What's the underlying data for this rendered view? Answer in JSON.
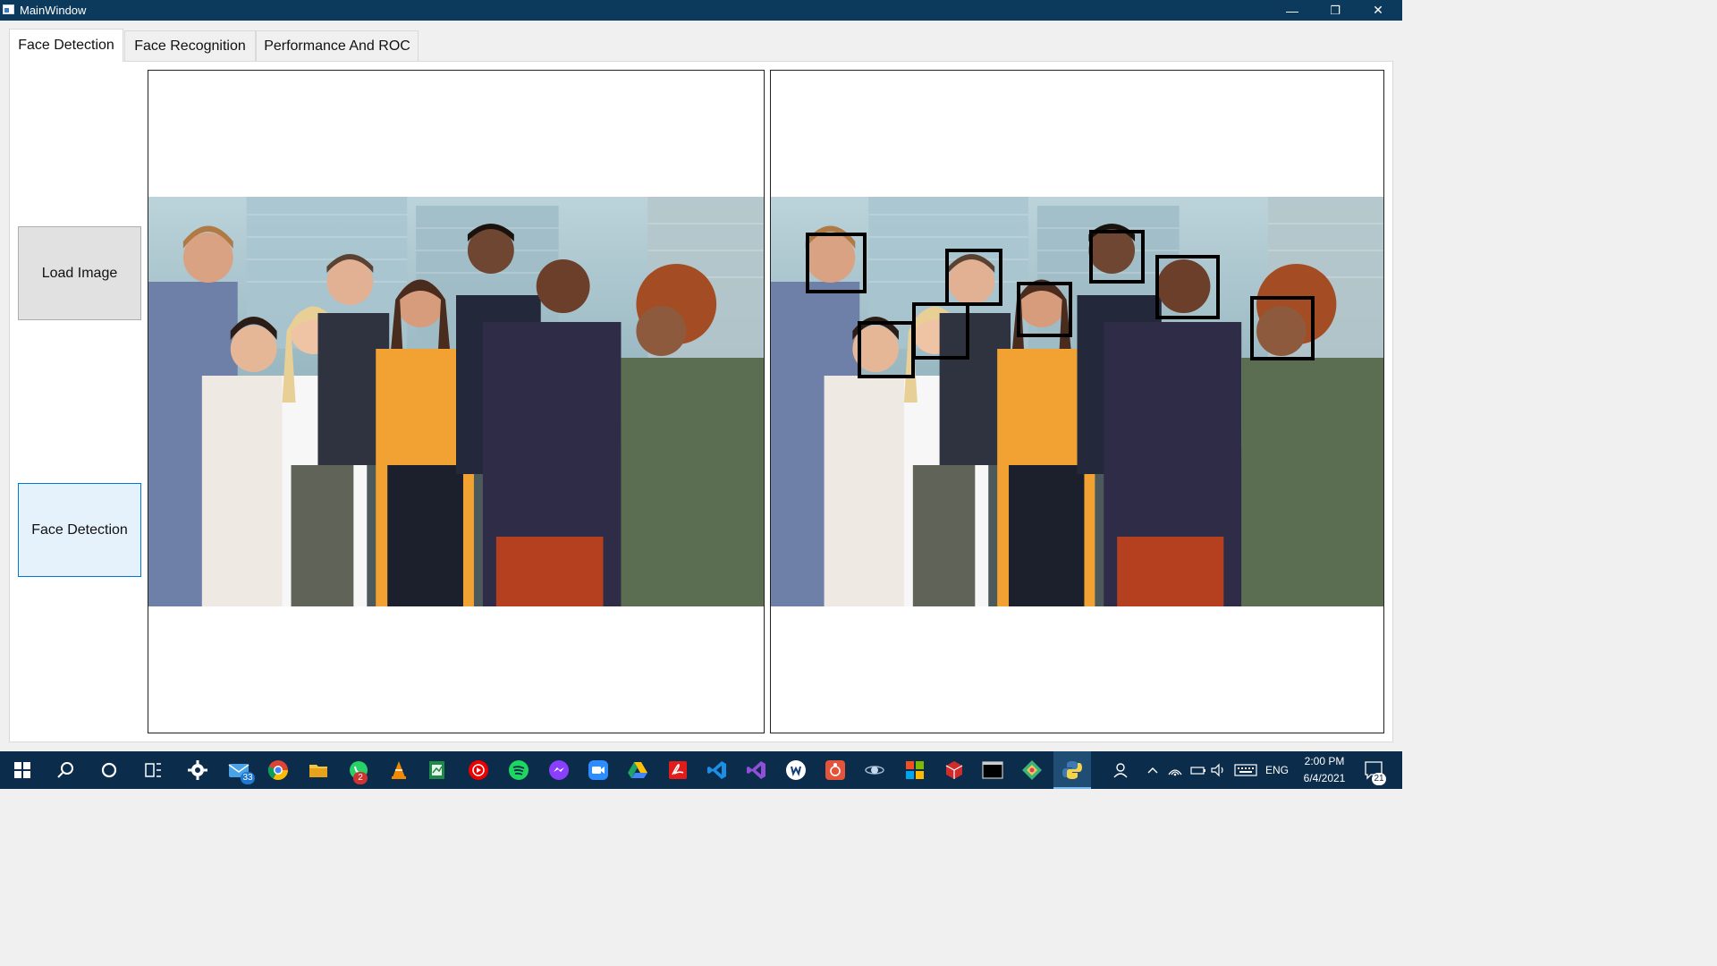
{
  "window": {
    "title": "MainWindow",
    "controls": {
      "minimize": "—",
      "maximize": "❐",
      "close": "✕"
    }
  },
  "tabs": [
    {
      "label": "Face Detection",
      "active": true
    },
    {
      "label": "Face Recognition",
      "active": false
    },
    {
      "label": "Performance And ROC",
      "active": false
    }
  ],
  "buttons": {
    "load_image": "Load Image",
    "face_detection": "Face Detection"
  },
  "views": {
    "input_image": "original group photo",
    "output_image": "group photo with detected faces"
  },
  "detections": {
    "count": 8
  },
  "taskbar": {
    "apps": [
      "windows-start-icon",
      "search-icon",
      "cortana-icon",
      "task-view-icon",
      "settings-icon",
      "mail-icon",
      "chrome-icon",
      "file-explorer-icon",
      "whatsapp-icon",
      "vlc-icon",
      "spreadsheet-icon",
      "youtube-music-icon",
      "spotify-icon",
      "messenger-icon",
      "zoom-icon",
      "google-drive-icon",
      "acrobat-icon",
      "vscode-icon",
      "visual-studio-icon",
      "app-icon",
      "git-icon",
      "satellite-icon",
      "office-icon",
      "3d-icon",
      "terminal-icon",
      "sourcetree-icon",
      "python-icon"
    ],
    "mail_badge": "33",
    "whatsapp_badge": "2",
    "language": "ENG",
    "time": "2:00 PM",
    "date": "6/4/2021",
    "notifications": "21"
  },
  "colors": {
    "titlebar": "#0b3a5c",
    "taskbar": "#0b2c4a",
    "accent": "#0078d7"
  }
}
